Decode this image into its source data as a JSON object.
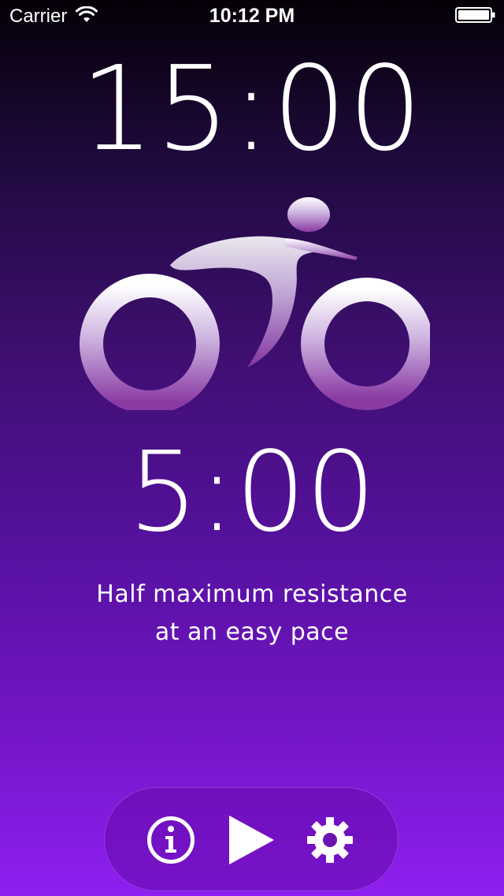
{
  "status_bar": {
    "carrier": "Carrier",
    "time": "10:12 PM",
    "icons": [
      "wifi-icon",
      "battery-icon"
    ]
  },
  "timer": {
    "total": "15:00",
    "interval": "5:00"
  },
  "instruction": {
    "line1": "Half maximum resistance",
    "line2": "at an easy pace"
  },
  "controls": {
    "info_icon": "info-icon",
    "play_icon": "play-icon",
    "settings_icon": "gear-icon"
  },
  "colors": {
    "background_top": "#050007",
    "background_bottom": "#8f1ff0",
    "text": "#ffffff",
    "control_bar": "#6a0db0"
  }
}
